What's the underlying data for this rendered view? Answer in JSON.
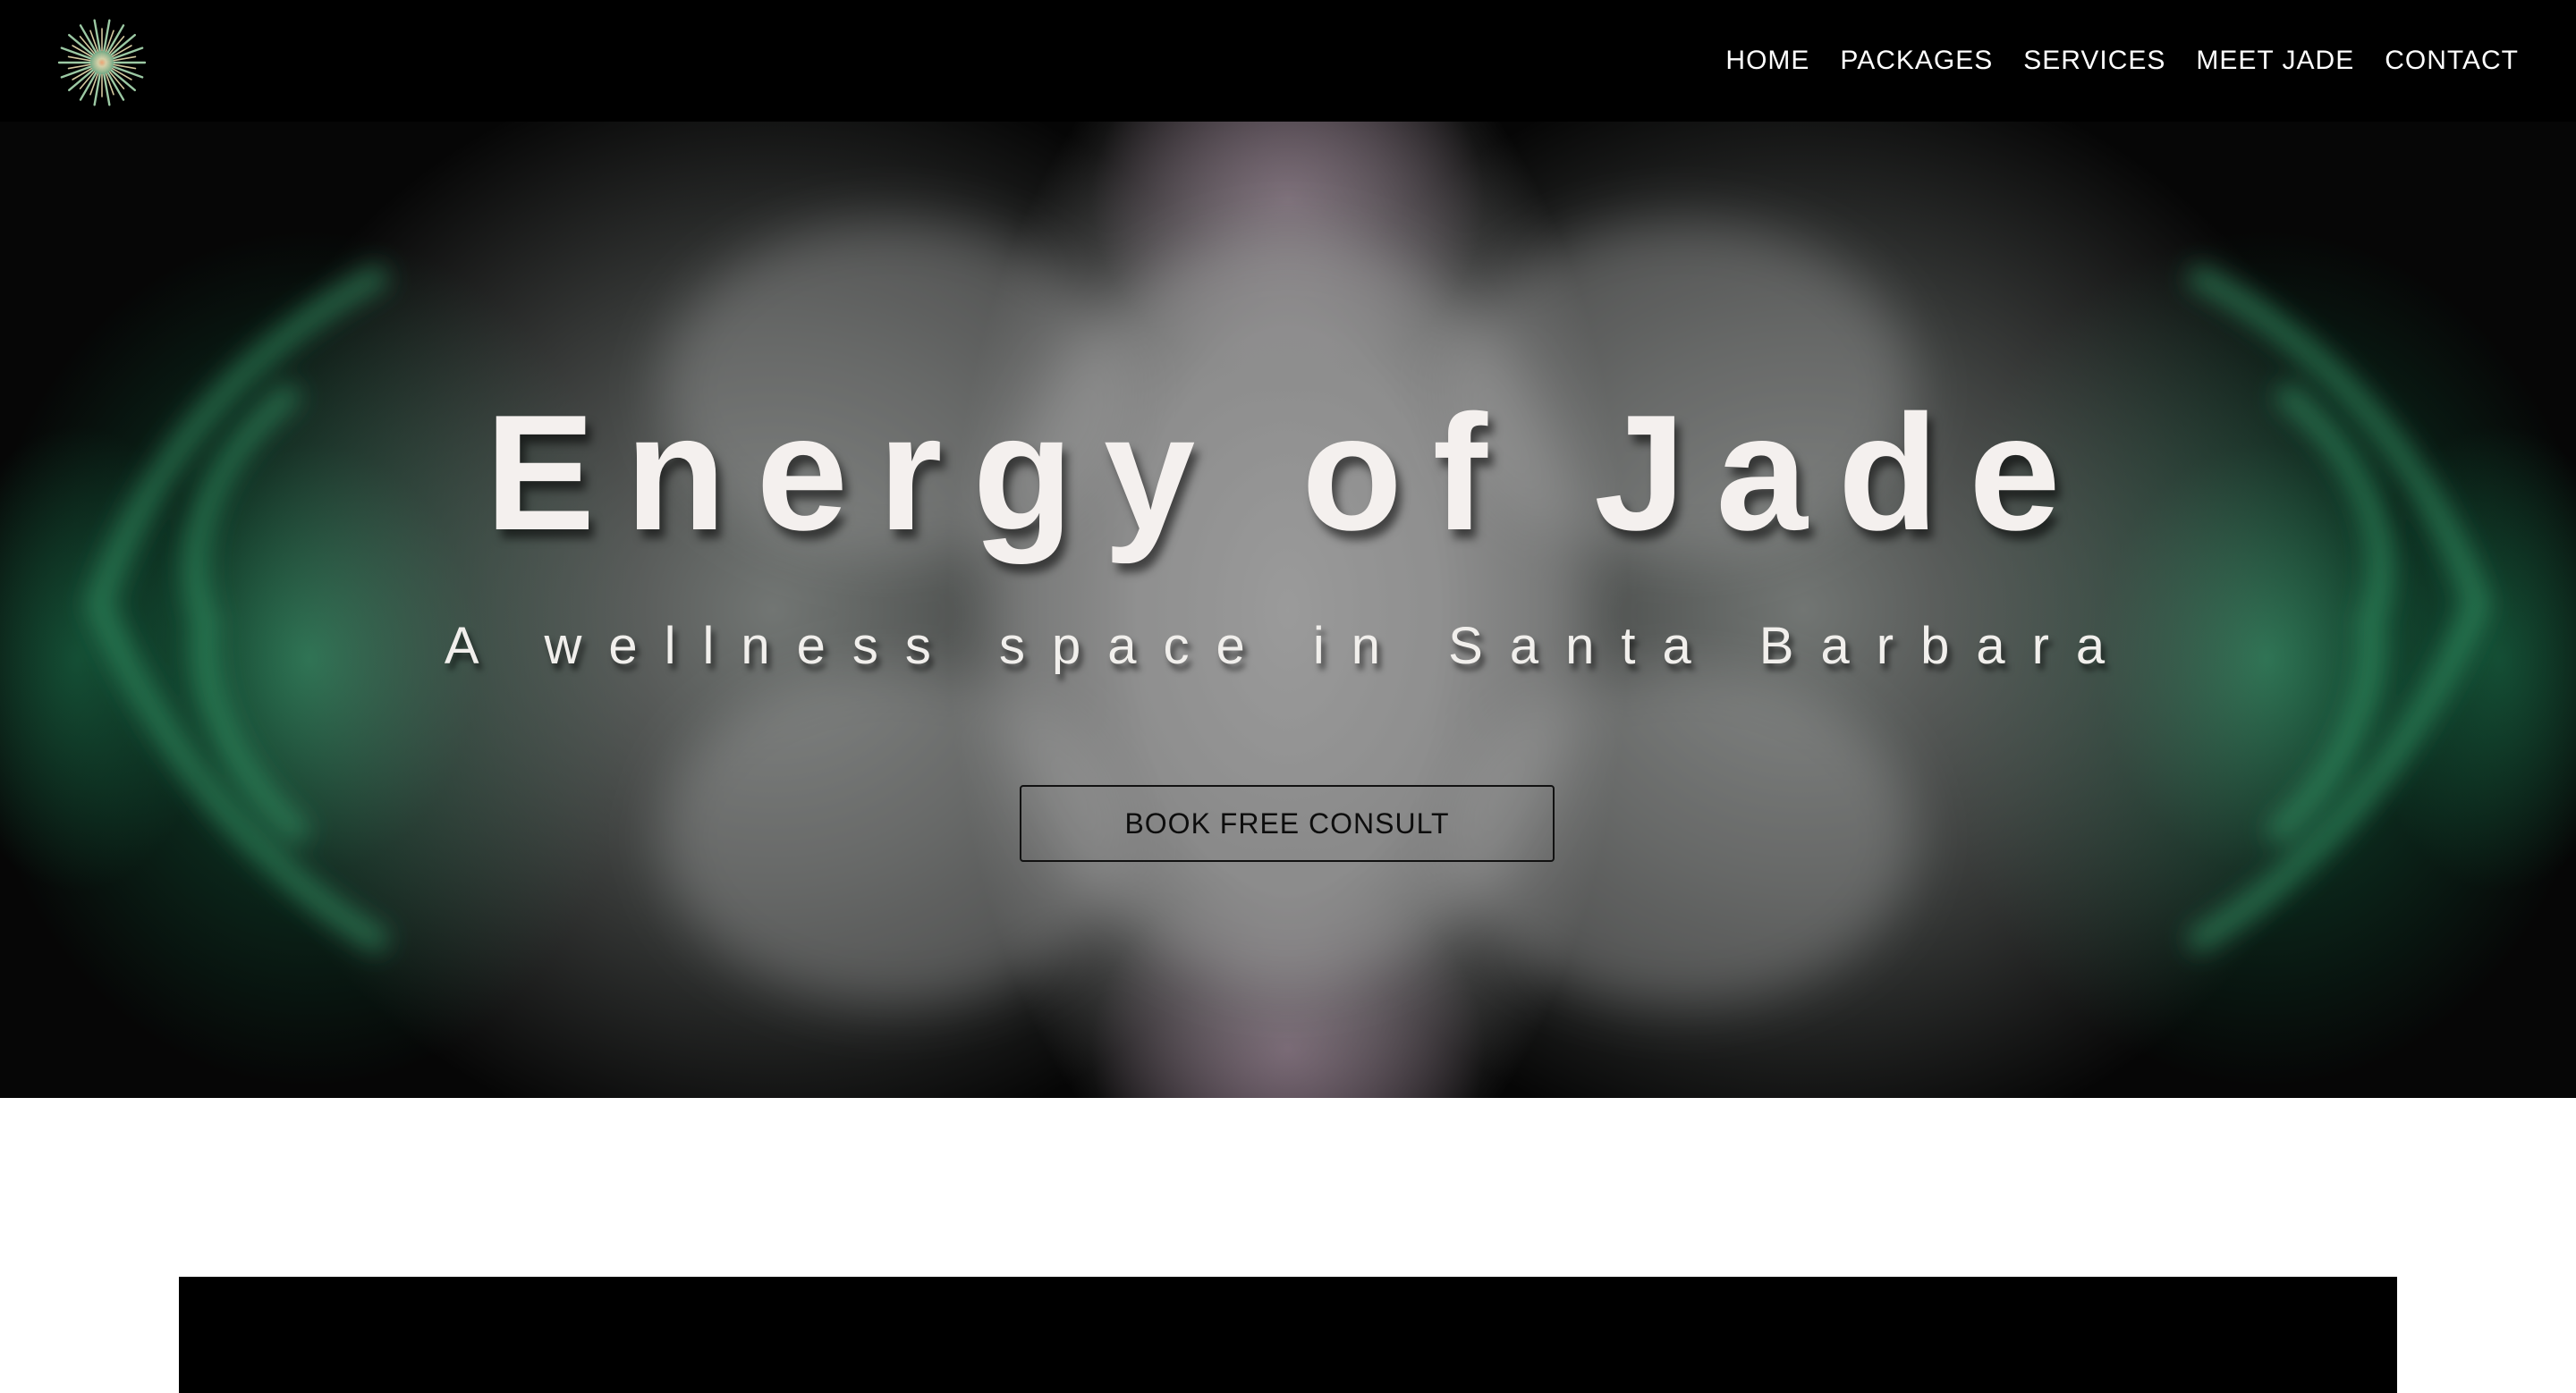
{
  "header": {
    "logo_icon": "starburst-logo-icon",
    "nav": [
      {
        "label": "HOME"
      },
      {
        "label": "PACKAGES"
      },
      {
        "label": "SERVICES"
      },
      {
        "label": "MEET JADE"
      },
      {
        "label": "CONTACT"
      }
    ]
  },
  "hero": {
    "title": "Energy of Jade",
    "subtitle": "A wellness space in Santa Barbara",
    "cta_label": "BOOK FREE CONSULT",
    "background_description_colors": {
      "smoke_center": "#9a9a9a",
      "smoke_green": "#2f9a6a",
      "smoke_pink": "#9a7a90",
      "base": "#060606"
    }
  },
  "colors": {
    "header_bg": "#000000",
    "nav_text": "#ffffff",
    "title_text": "#f4f0ee",
    "button_border": "#111111",
    "content_block": "#000000",
    "page_bg": "#ffffff"
  }
}
